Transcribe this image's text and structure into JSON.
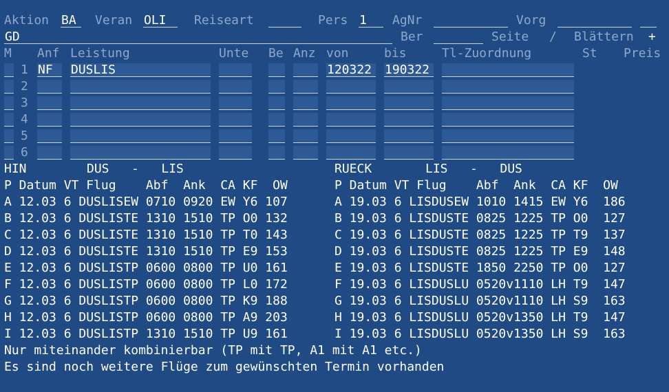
{
  "header": {
    "aktion_label": "Aktion",
    "aktion_value": "BA",
    "veran_label": "Veran",
    "veran_value": "OLI",
    "reiseart_label": "Reiseart",
    "reiseart_value": "",
    "pers_label": "Pers",
    "pers_value": "1",
    "agnr_label": "AgNr",
    "agnr_value": "",
    "vorg_label": "Vorg",
    "vorg_value": "",
    "vorg_extra": "",
    "gd_value": "GD",
    "ber_label": "Ber",
    "ber_value": "",
    "seite_label": "Seite",
    "slash": "/",
    "blaettern_label": "Blättern",
    "blaettern_value": "+"
  },
  "columns": {
    "m": "M",
    "anf": "Anf",
    "leistung": "Leistung",
    "unte": "Unte",
    "be": "Be",
    "anz": "Anz",
    "von": "von",
    "bis": "bis",
    "tl": "Tl-Zuordnung",
    "st": "St",
    "preis": "Preis"
  },
  "services": [
    {
      "num": "1",
      "anf": "NF",
      "leistung": "DUSLIS",
      "von": "120322",
      "bis": "190322"
    },
    {
      "num": "2",
      "anf": "",
      "leistung": "",
      "von": "",
      "bis": ""
    },
    {
      "num": "3",
      "anf": "",
      "leistung": "",
      "von": "",
      "bis": ""
    },
    {
      "num": "4",
      "anf": "",
      "leistung": "",
      "von": "",
      "bis": ""
    },
    {
      "num": "5",
      "anf": "",
      "leistung": "",
      "von": "",
      "bis": ""
    },
    {
      "num": "6",
      "anf": "",
      "leistung": "",
      "von": "",
      "bis": ""
    }
  ],
  "hin": {
    "label": "HIN",
    "route": "DUS   -   LIS"
  },
  "rueck": {
    "label": "RUECK",
    "route": "LIS   -   DUS"
  },
  "flight_header": "P Datum VT Flug    Abf  Ank  CA KF  OW",
  "hin_flights": [
    "A 12.03 6 DUSLISEW 0710 0920 EW Y6 107",
    "B 12.03 6 DUSLISTE 1310 1510 TP O0 132",
    "C 12.03 6 DUSLISTE 1310 1510 TP T0 143",
    "D 12.03 6 DUSLISTE 1310 1510 TP E9 153",
    "E 12.03 6 DUSLISTP 0600 0800 TP U0 161",
    "F 12.03 6 DUSLISTP 0600 0800 TP L0 172",
    "G 12.03 6 DUSLISTP 0600 0800 TP K9 188",
    "H 12.03 6 DUSLISTP 0600 0800 TP A9 203",
    "I 12.03 6 DUSLISTP 1310 1510 TP U9 161"
  ],
  "rueck_flights": [
    "A 19.03 6 LISDUSEW 1010 1415 EW Y6  186",
    "B 19.03 6 LISDUSTE 0825 1225 TP O0  127",
    "C 19.03 6 LISDUSTE 0825 1225 TP T9  137",
    "D 19.03 6 LISDUSTE 0825 1225 TP E9  148",
    "E 19.03 6 LISDUSTE 1850 2250 TP O0  127",
    "F 19.03 6 LISDUSLU 0520v1110 LH T9  147",
    "G 19.03 6 LISDUSLU 0520v1110 LH S9  163",
    "H 19.03 6 LISDUSLU 0520v1350 LH T9  147",
    "I 19.03 6 LISDUSLU 0520v1350 LH S9  163"
  ],
  "footer": {
    "line1": "Nur miteinander kombinierbar (TP mit TP, A1 mit A1 etc.)",
    "line2": "Es sind noch weitere Flüge zum gewünschten Termin vorhanden"
  },
  "colors": {
    "background": "#1f4a84",
    "field": "#2d5a94",
    "label": "#8fa8cc",
    "text": "#ffffff"
  }
}
